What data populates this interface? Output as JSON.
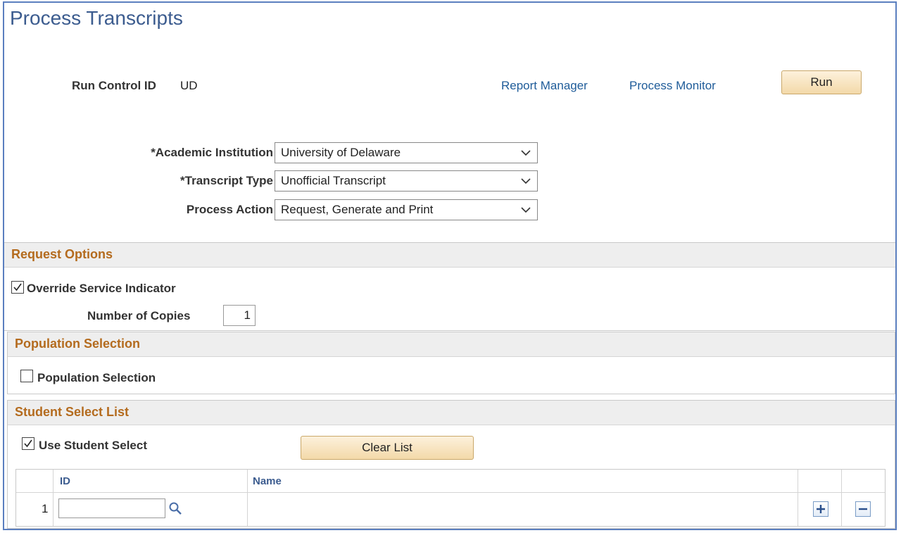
{
  "page": {
    "title": "Process Transcripts"
  },
  "run_control": {
    "label": "Run Control ID",
    "value": "UD"
  },
  "links": {
    "report_manager": "Report Manager",
    "process_monitor": "Process Monitor"
  },
  "buttons": {
    "run": "Run",
    "clear_list": "Clear List"
  },
  "form": {
    "academic_institution": {
      "label": "*Academic Institution",
      "value": "University of Delaware"
    },
    "transcript_type": {
      "label": "*Transcript Type",
      "value": "Unofficial Transcript"
    },
    "process_action": {
      "label": "Process Action",
      "value": "Request, Generate and Print"
    }
  },
  "request_options": {
    "title": "Request Options",
    "override_label": "Override Service Indicator",
    "override_checked": true,
    "copies_label": "Number of Copies",
    "copies_value": "1"
  },
  "population": {
    "title": "Population Selection",
    "checkbox_label": "Population Selection",
    "checked": false
  },
  "student_select": {
    "title": "Student Select List",
    "checkbox_label": "Use Student Select",
    "checked": true,
    "columns": {
      "id": "ID",
      "name": "Name"
    },
    "rows": [
      {
        "num": "1",
        "id": "",
        "name": ""
      }
    ]
  },
  "icons": {
    "dropdown": "chevron-down-icon",
    "search": "magnifier-icon",
    "add": "plus-icon",
    "remove": "minus-icon",
    "checkbox": "checkmark-icon"
  },
  "colors": {
    "title": "#3c5c8f",
    "link": "#1f5c99",
    "section_title": "#b46b1e",
    "border": "#5b7fbf",
    "button_fill": "#f3d9a9"
  }
}
